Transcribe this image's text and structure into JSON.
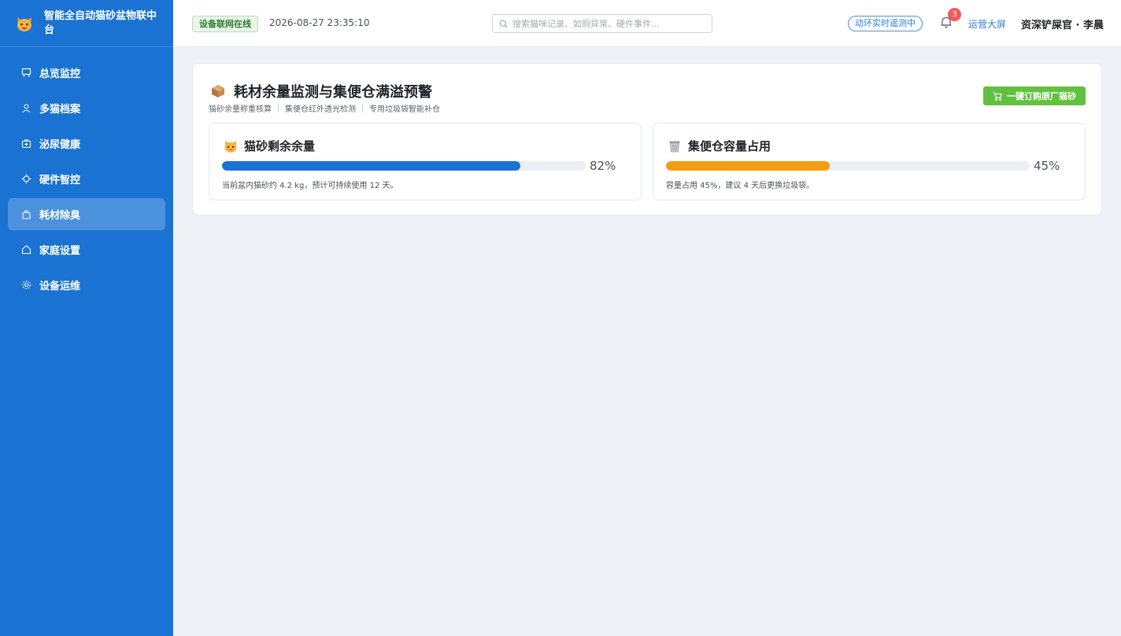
{
  "app": {
    "title": "智能全自动猫砂盆物联中台"
  },
  "sidebar": {
    "items": [
      {
        "label": "总览监控",
        "icon": "dashboard-icon"
      },
      {
        "label": "多猫档案",
        "icon": "user-icon"
      },
      {
        "label": "泌尿健康",
        "icon": "medical-kit-icon"
      },
      {
        "label": "硬件智控",
        "icon": "chip-icon"
      },
      {
        "label": "耗材除臭",
        "icon": "bag-icon",
        "active": true
      },
      {
        "label": "家庭设置",
        "icon": "home-icon"
      },
      {
        "label": "设备运维",
        "icon": "gear-icon"
      }
    ]
  },
  "header": {
    "status": "设备联网在线",
    "datetime": "2026-08-27 23:35:10",
    "search_placeholder": "搜索猫咪记录、如厕异常、硬件事件...",
    "monitor_pill": "动环实时遥测中",
    "notification_count": "3",
    "ops_link": "运营大屏",
    "user": "资深铲屎官 · 李晨"
  },
  "consumables": {
    "title": "耗材余量监测与集便仓满溢预警",
    "tags": [
      "猫砂余量称重核算",
      "集便仓红外透光检测",
      "专用垃圾袋智能补仓"
    ],
    "buy_button": "一键订购原厂猫砂",
    "litter": {
      "title": "猫砂剩余余量",
      "percent": 82,
      "percent_label": "82%",
      "description": "当前盆内猫砂约 4.2 kg，预计可持续使用 12 天。",
      "color": "#1a73d2"
    },
    "bin": {
      "title": "集便仓容量占用",
      "percent": 45,
      "percent_label": "45%",
      "description": "容量占用 45%，建议 4 天后更换垃圾袋。",
      "color": "#f39c12"
    }
  },
  "colors": {
    "sidebar": "#1a73d2",
    "accent_green": "#62c13f",
    "badge_red": "#f05b5b"
  }
}
